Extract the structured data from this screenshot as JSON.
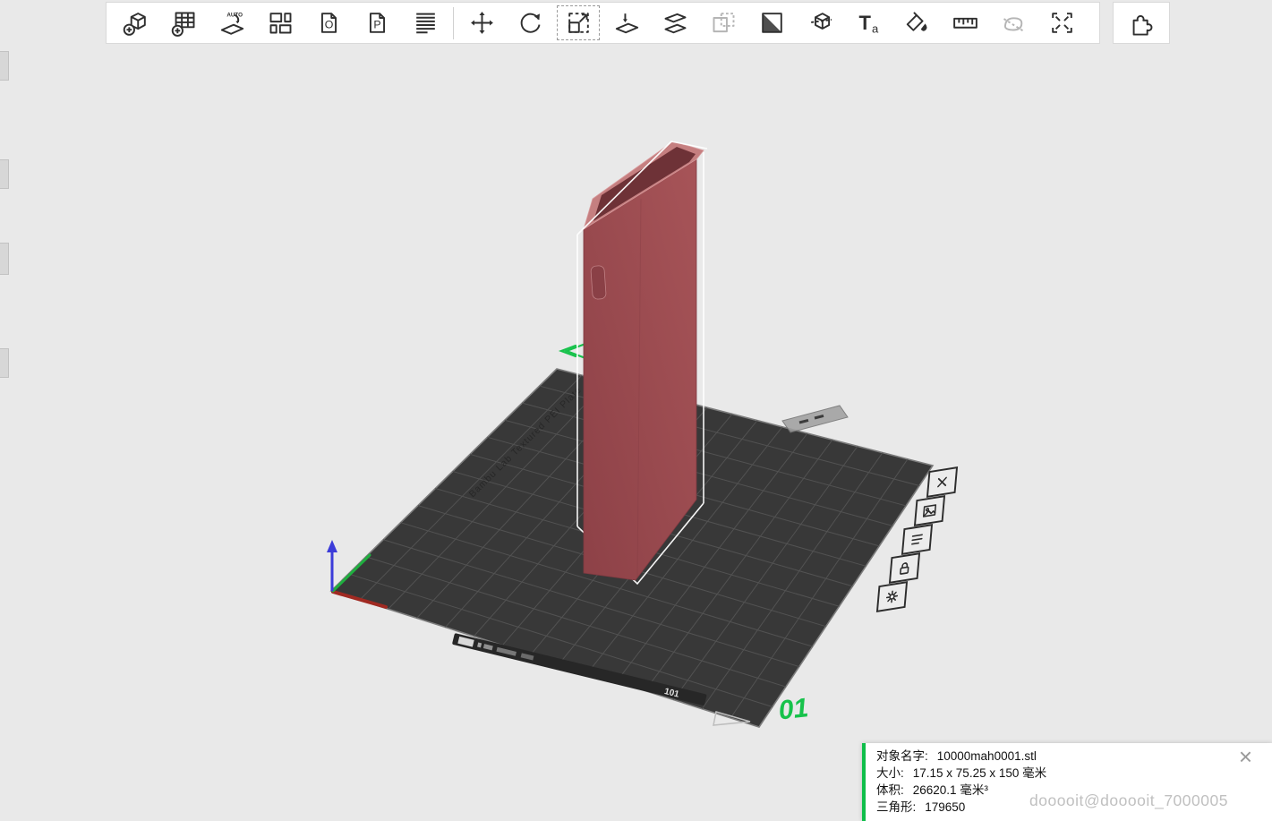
{
  "colors": {
    "background": "#e9e9e9",
    "toolbar_bg": "#ffffff",
    "icon": "#2f2f2f",
    "icon_disabled": "#b5b5b5",
    "plate": "#383838",
    "plate_grid": "#525252",
    "model_main": "#a75458",
    "model_dark": "#8d4147",
    "model_rim": "#c57f80",
    "model_interior": "#6e3237",
    "selection_white": "#ffffff",
    "accent_green": "#17c24b",
    "axis_x_red": "#a02a22",
    "axis_y_green": "#1faf3f",
    "axis_z_blue": "#3c3cd9",
    "panel_green": "#0fbe4a",
    "watermark_gray": "#c0c0c0"
  },
  "toolbar": {
    "items": [
      {
        "name": "add-object-icon",
        "title": "Add object"
      },
      {
        "name": "add-plate-icon",
        "title": "Add plate"
      },
      {
        "name": "auto-orient-icon",
        "title": "Auto orient"
      },
      {
        "name": "arrange-icon",
        "title": "Arrange all objects"
      },
      {
        "name": "copy-icon",
        "title": "Copy"
      },
      {
        "name": "paste-icon",
        "title": "Paste"
      },
      {
        "name": "layers-icon",
        "title": "Object list"
      },
      {
        "type": "divider"
      },
      {
        "name": "move-icon",
        "title": "Move"
      },
      {
        "name": "rotate-icon",
        "title": "Rotate"
      },
      {
        "name": "scale-icon",
        "title": "Scale",
        "active": true
      },
      {
        "name": "lay-on-face-icon",
        "title": "Lay on face"
      },
      {
        "name": "cut-icon",
        "title": "Cut"
      },
      {
        "name": "mirror-icon",
        "title": "Mirror",
        "disabled": true
      },
      {
        "name": "split-objects-icon",
        "title": "Split to objects"
      },
      {
        "name": "split-parts-icon",
        "title": "Split to parts"
      },
      {
        "name": "text-icon",
        "title": "Add text"
      },
      {
        "name": "paint-icon",
        "title": "Color painting"
      },
      {
        "name": "measure-icon",
        "title": "Measure"
      },
      {
        "name": "seam-icon",
        "title": "Seam painting",
        "disabled": true
      },
      {
        "name": "assembly-icon",
        "title": "Assembly view"
      }
    ],
    "plugin_item": {
      "name": "plugin-puzzle-icon",
      "title": "Plugins"
    }
  },
  "viewport": {
    "plate_number": "01",
    "plate_edge_code": "101",
    "plate_brand_text": "Bambu Lab Textured PEI Plate",
    "model_name": "10000mah0001.stl",
    "side_buttons": [
      {
        "name": "delete-plate-icon"
      },
      {
        "name": "plate-settings-icon"
      },
      {
        "name": "plate-list-icon"
      },
      {
        "name": "lock-plate-icon"
      },
      {
        "name": "plate-gear-icon"
      }
    ]
  },
  "info_panel": {
    "rows": [
      {
        "label": "对象名字:",
        "value": "10000mah0001.stl"
      },
      {
        "label": "大小:",
        "value": "17.15 x 75.25 x 150 毫米"
      },
      {
        "label": "体积:",
        "value": "26620.1 毫米³"
      },
      {
        "label": "三角形:",
        "value": "179650"
      }
    ],
    "close_glyph": "×"
  },
  "watermark": "dooooit@dooooit_7000005"
}
